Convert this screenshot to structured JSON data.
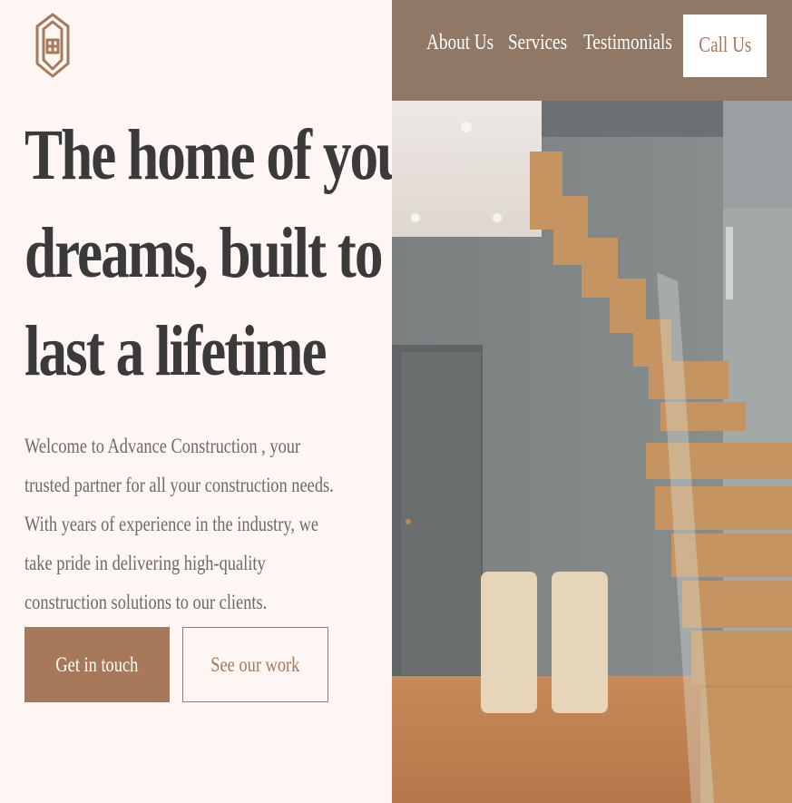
{
  "brand": {
    "logo_icon": "house-monogram-logo-icon",
    "accent": "#a6795a"
  },
  "nav": {
    "links": [
      "About Us",
      "Services",
      "Testimonials"
    ],
    "cta_label": "Call Us"
  },
  "hero": {
    "headline_lines": [
      "The home of your",
      "dreams, built to",
      "last a lifetime"
    ],
    "intro": "Welcome to Advance Construction , your trusted partner for all your construction needs. With years of experience in the industry, we take pride in delivering high-quality construction solutions to our clients.",
    "primary_button": "Get in touch",
    "secondary_button": "See our work"
  },
  "image": {
    "subject": "staircase-interior-photo"
  }
}
